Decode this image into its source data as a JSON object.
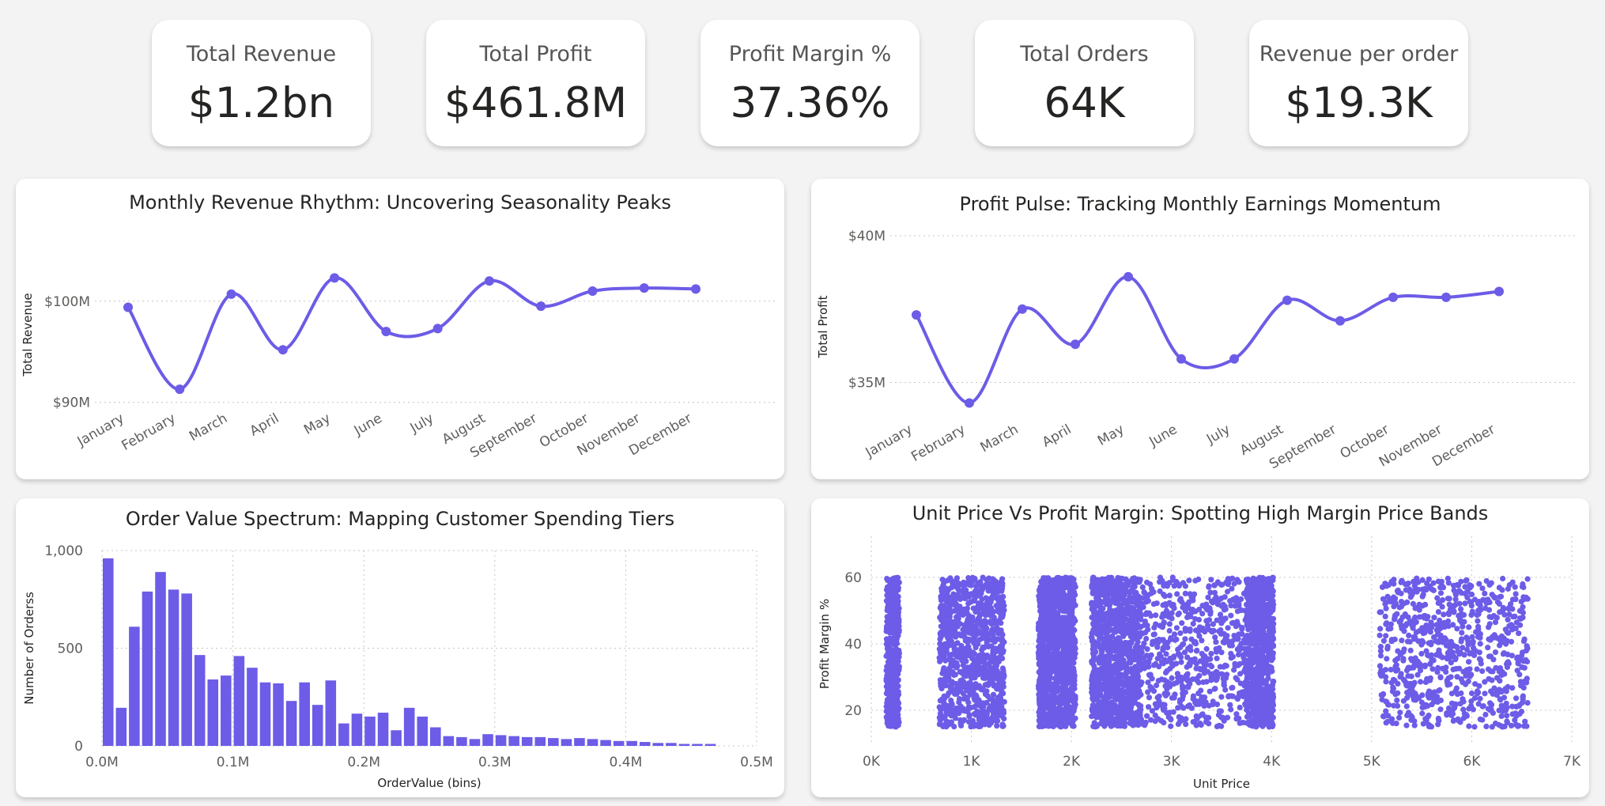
{
  "kpis": [
    {
      "label": "Total Revenue",
      "value": "$1.2bn"
    },
    {
      "label": "Total Profit",
      "value": "$461.8M"
    },
    {
      "label": "Profit Margin %",
      "value": "37.36%"
    },
    {
      "label": "Total Orders",
      "value": "64K"
    },
    {
      "label": "Revenue per order",
      "value": "$19.3K"
    }
  ],
  "accent_color": "#6c5ce7",
  "chart_data": [
    {
      "type": "line",
      "title": "Monthly Revenue Rhythm: Uncovering Seasonality Peaks",
      "xlabel": "",
      "ylabel": "Total Revenue",
      "categories": [
        "January",
        "February",
        "March",
        "April",
        "May",
        "June",
        "July",
        "August",
        "September",
        "October",
        "November",
        "December"
      ],
      "values": [
        99.4,
        91.3,
        100.7,
        95.2,
        102.3,
        97.0,
        97.3,
        102.0,
        99.5,
        101.0,
        101.3,
        101.2
      ],
      "value_unit": "M",
      "ylim": [
        89.9,
        103.5
      ],
      "yticks": [
        90,
        100
      ],
      "ytick_labels": [
        "$90M",
        "$100M"
      ],
      "grid": true
    },
    {
      "type": "line",
      "title": "Profit Pulse: Tracking Monthly Earnings Momentum",
      "xlabel": "",
      "ylabel": "Total Profit",
      "categories": [
        "January",
        "February",
        "March",
        "April",
        "May",
        "June",
        "July",
        "August",
        "September",
        "October",
        "November",
        "December"
      ],
      "values": [
        37.3,
        34.3,
        37.5,
        36.3,
        38.6,
        35.8,
        35.8,
        37.8,
        37.1,
        37.9,
        37.9,
        38.1
      ],
      "value_unit": "M",
      "ylim": [
        33.8,
        40.0
      ],
      "yticks": [
        35,
        40
      ],
      "ytick_labels": [
        "$35M",
        "$40M"
      ],
      "grid": true
    },
    {
      "type": "bar",
      "title": "Order Value Spectrum: Mapping Customer Spending Tiers",
      "xlabel": "OrderValue (bins)",
      "ylabel": "Number of Orderss",
      "bin_width": 0.01,
      "bin_starts": [
        0.0,
        0.01,
        0.02,
        0.03,
        0.04,
        0.05,
        0.06,
        0.07,
        0.08,
        0.09,
        0.1,
        0.11,
        0.12,
        0.13,
        0.14,
        0.15,
        0.16,
        0.17,
        0.18,
        0.19,
        0.2,
        0.21,
        0.22,
        0.23,
        0.24,
        0.25,
        0.26,
        0.27,
        0.28,
        0.29,
        0.3,
        0.31,
        0.32,
        0.33,
        0.34,
        0.35,
        0.36,
        0.37,
        0.38,
        0.39,
        0.4,
        0.41,
        0.42,
        0.43,
        0.44,
        0.45,
        0.46
      ],
      "values": [
        960,
        195,
        610,
        790,
        890,
        800,
        780,
        465,
        340,
        360,
        460,
        400,
        325,
        320,
        230,
        325,
        210,
        335,
        115,
        165,
        150,
        170,
        80,
        195,
        150,
        95,
        50,
        45,
        35,
        60,
        55,
        50,
        45,
        45,
        40,
        35,
        40,
        35,
        30,
        25,
        25,
        20,
        15,
        15,
        10,
        10,
        10
      ],
      "xlim": [
        0,
        0.5
      ],
      "xticks": [
        0,
        0.1,
        0.2,
        0.3,
        0.4,
        0.5
      ],
      "xtick_labels": [
        "0.0M",
        "0.1M",
        "0.2M",
        "0.3M",
        "0.4M",
        "0.5M"
      ],
      "ylim": [
        0,
        1000
      ],
      "yticks": [
        0,
        500,
        1000
      ],
      "ytick_labels": [
        "0",
        "500",
        "1,000"
      ],
      "grid": true
    },
    {
      "type": "scatter",
      "title": "Unit Price Vs Profit Margin: Spotting High Margin Price Bands",
      "xlabel": "Unit Price",
      "ylabel": "Profit Margin %",
      "xlim": [
        0,
        7000
      ],
      "xticks": [
        0,
        1000,
        2000,
        3000,
        4000,
        5000,
        6000,
        7000
      ],
      "xtick_labels": [
        "0K",
        "1K",
        "2K",
        "3K",
        "4K",
        "5K",
        "6K",
        "7K"
      ],
      "ylim": [
        10,
        70
      ],
      "yticks": [
        20,
        40,
        60
      ],
      "ytick_labels": [
        "20",
        "40",
        "60"
      ],
      "margin_range": [
        15,
        60
      ],
      "price_bands": [
        {
          "x_range": [
            150,
            280
          ],
          "count": 420
        },
        {
          "x_range": [
            680,
            1330
          ],
          "count": 950
        },
        {
          "x_range": [
            1670,
            2040
          ],
          "count": 1050
        },
        {
          "x_range": [
            2200,
            2700
          ],
          "count": 1000
        },
        {
          "x_range": [
            2700,
            3750
          ],
          "count": 600
        },
        {
          "x_range": [
            3750,
            4020
          ],
          "count": 750
        },
        {
          "x_range": [
            5080,
            6560
          ],
          "count": 780
        }
      ],
      "grid": true
    }
  ]
}
